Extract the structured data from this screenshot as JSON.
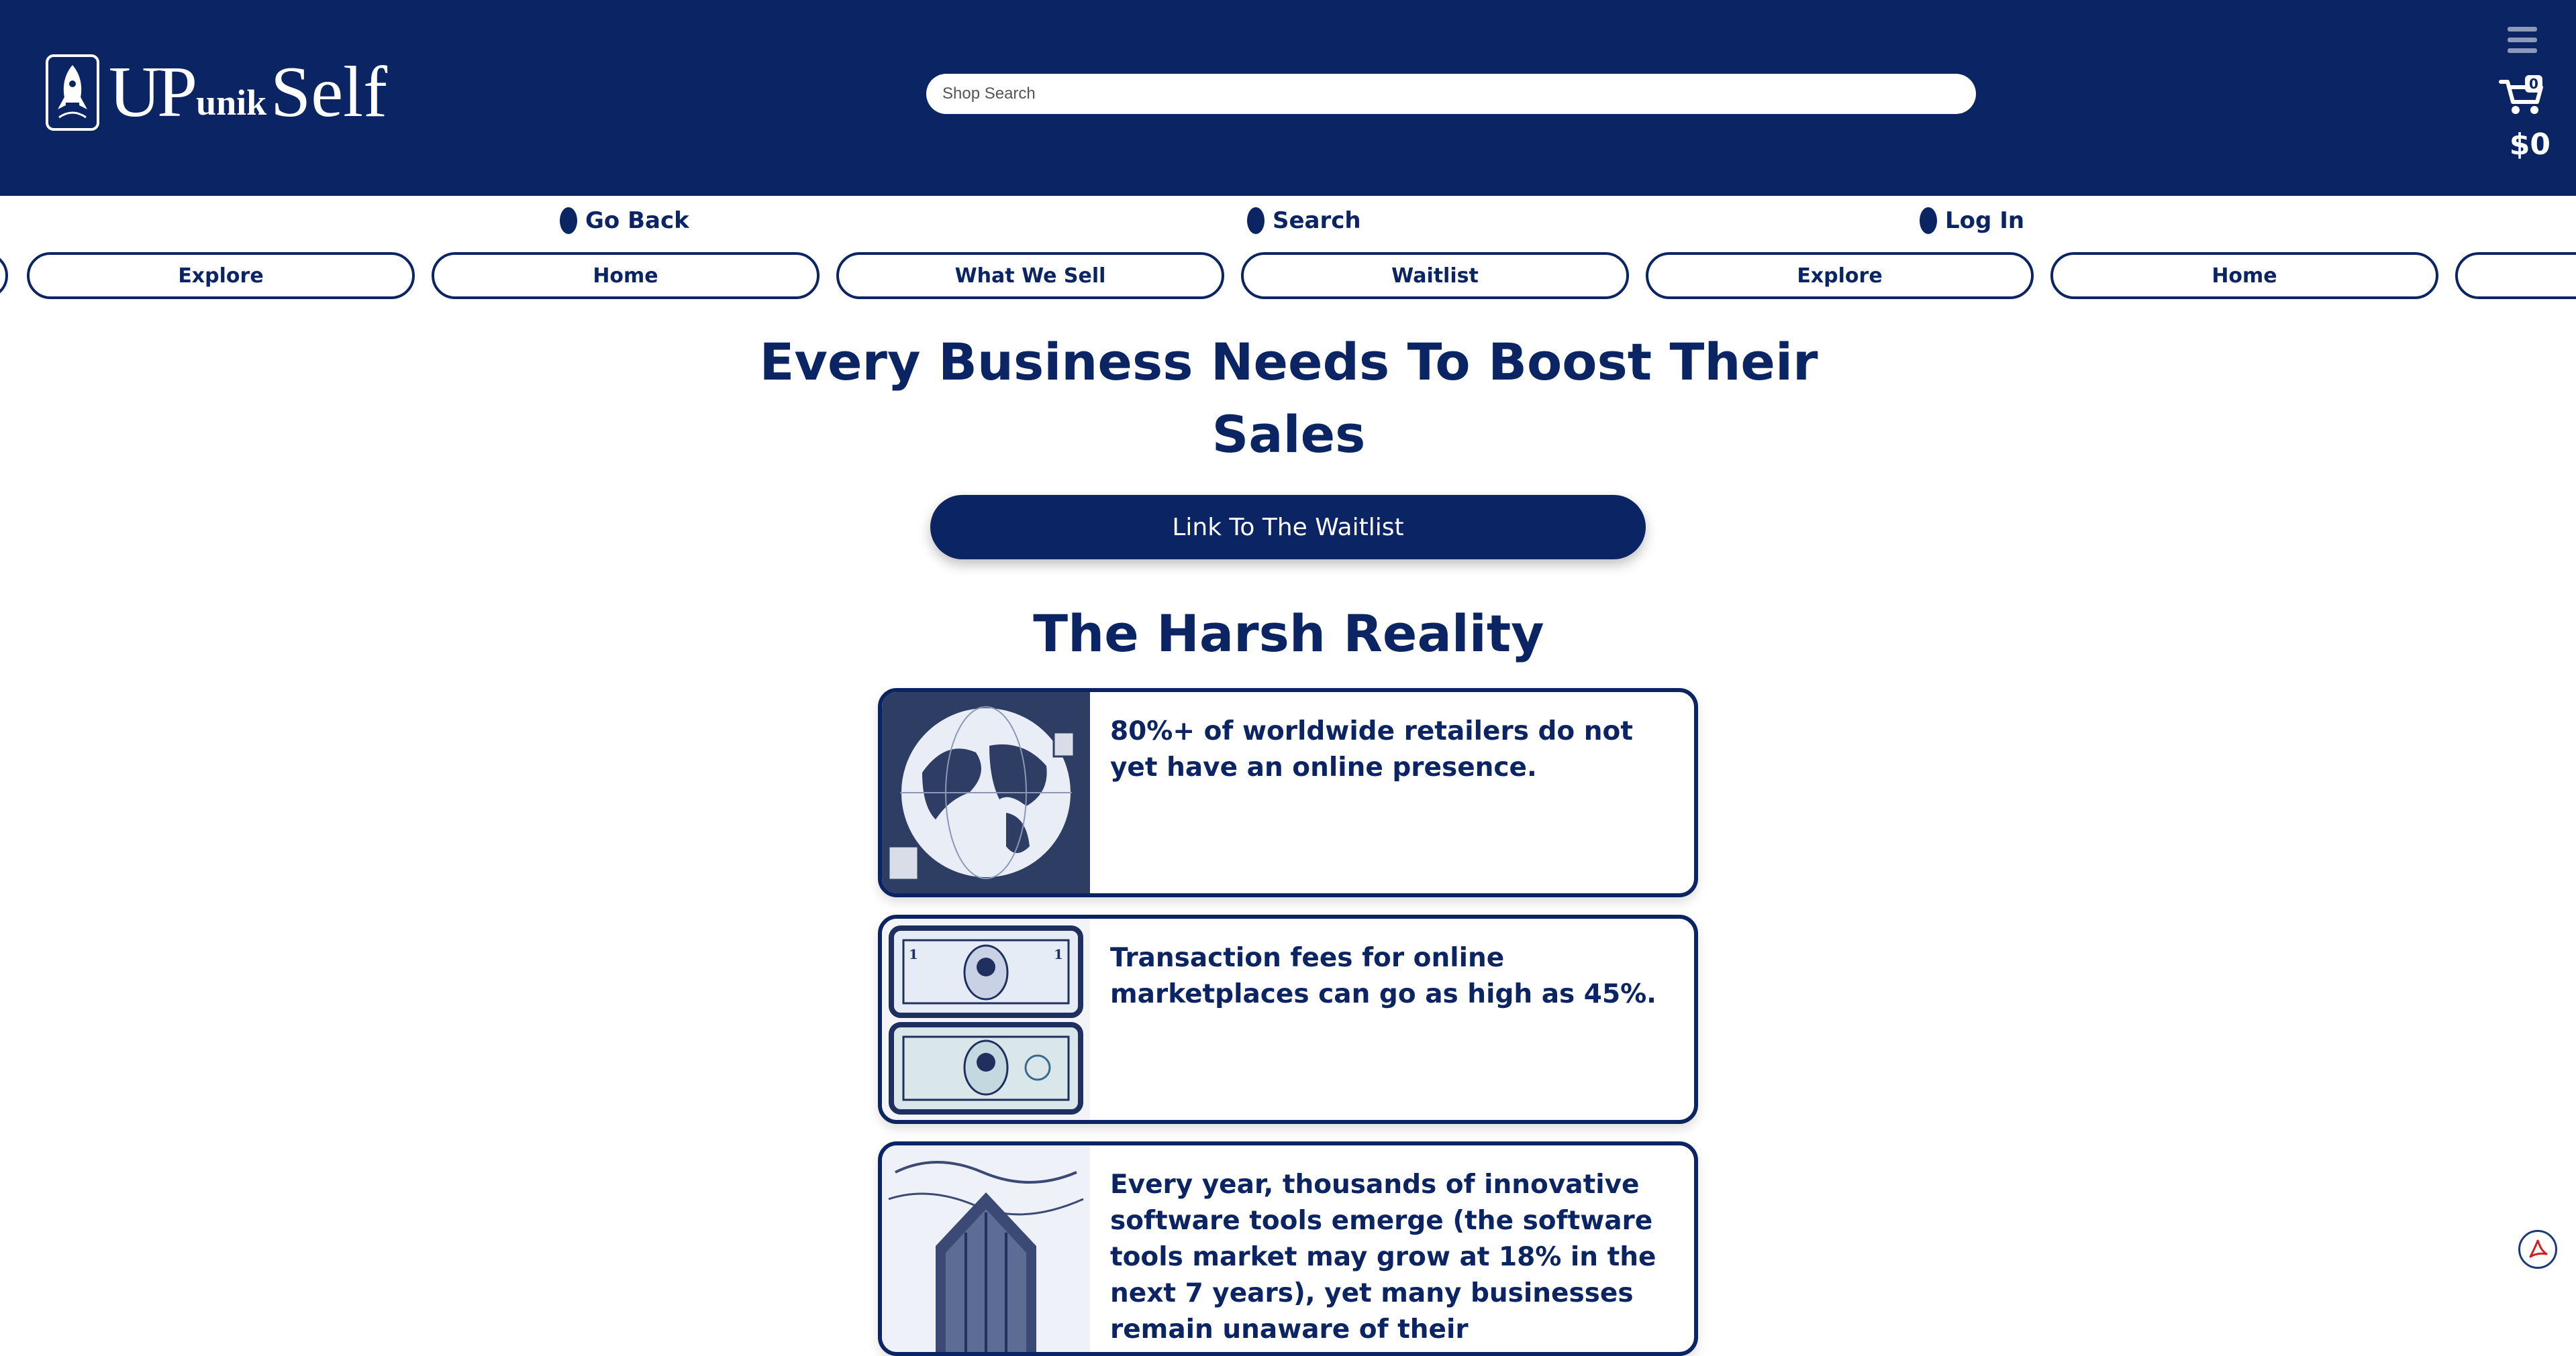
{
  "header": {
    "logo": {
      "up": "UP",
      "unik": "unik",
      "self": "Self"
    },
    "search": {
      "placeholder": "Shop Search"
    },
    "cart": {
      "count": "0",
      "total": "$0"
    }
  },
  "nav_links": [
    "Go Back",
    "Search",
    "Log In"
  ],
  "pills": [
    "Explore",
    "Home",
    "What We Sell",
    "Waitlist",
    "Explore",
    "Home"
  ],
  "main": {
    "heading_line1": "Every Business Needs To Boost Their",
    "heading_line2": "Sales",
    "cta": "Link To The Waitlist",
    "section_title": "The Harsh Reality",
    "cards": [
      {
        "text": "80%+ of worldwide retailers do not yet have an online presence."
      },
      {
        "text": "Transaction fees for online marketplaces can go as high as 45%."
      },
      {
        "text": "Every year, thousands of innovative software tools emerge (the software tools market may grow at 18% in the next 7 years), yet many businesses remain unaware of their"
      }
    ]
  },
  "colors": {
    "primary": "#0b2463",
    "background": "#ffffff"
  }
}
